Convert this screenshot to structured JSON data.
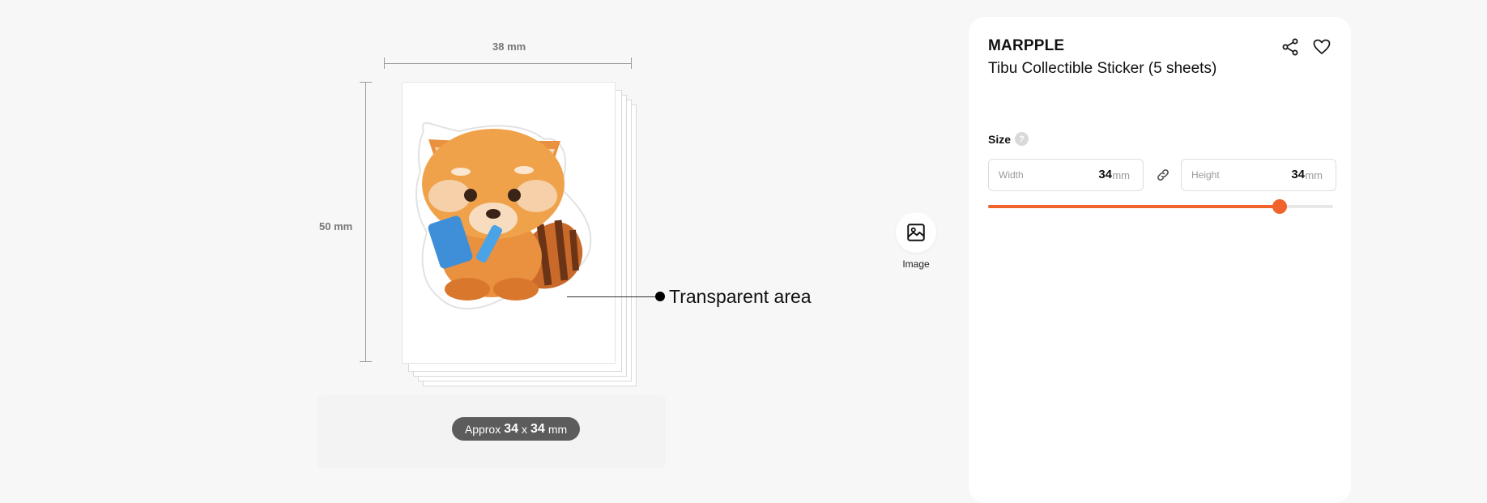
{
  "preview": {
    "width_dimension": "38 mm",
    "height_dimension": "50 mm",
    "transparent_callout": "Transparent area",
    "approx": {
      "prefix": "Approx",
      "width": "34",
      "times": "x",
      "height": "34",
      "unit": "mm"
    },
    "image_tool_label": "Image"
  },
  "product": {
    "brand": "MARPPLE",
    "title": "Tibu Collectible Sticker (5 sheets)"
  },
  "size": {
    "label": "Size",
    "help_glyph": "?",
    "width": {
      "label": "Width",
      "value": "34",
      "unit": "mm"
    },
    "height": {
      "label": "Height",
      "value": "34",
      "unit": "mm"
    },
    "slider_level": 0.845
  },
  "colors": {
    "accent": "#f0632c"
  },
  "icons": [
    "share-icon",
    "heart-icon",
    "link-icon",
    "image-icon",
    "help-icon"
  ]
}
